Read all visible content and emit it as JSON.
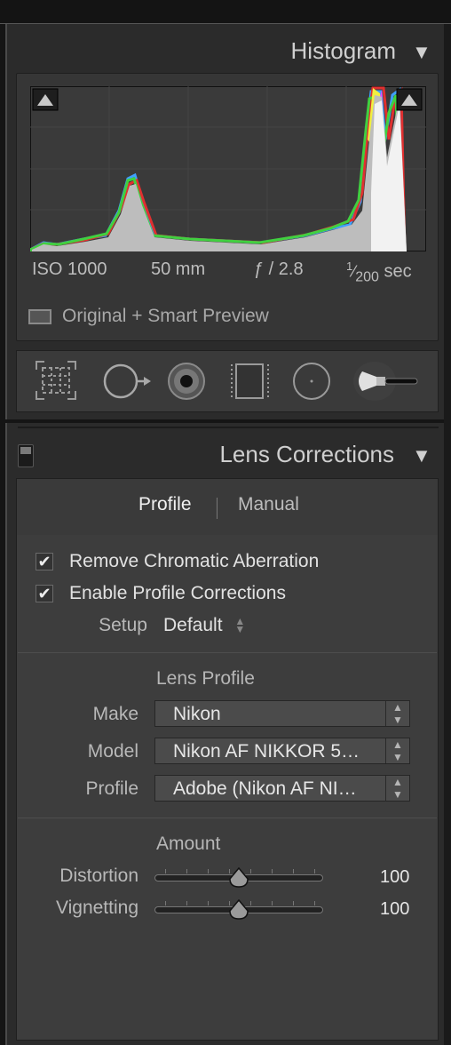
{
  "histogram_panel": {
    "title": "Histogram",
    "collapse_glyph": "▼",
    "metadata": {
      "iso": "ISO 1000",
      "focal_length": "50 mm",
      "aperture": "ƒ / 2.8",
      "shutter_num": "1",
      "shutter_den": "200",
      "shutter_unit": "sec"
    },
    "preview_status": "Original + Smart Preview"
  },
  "tool_strip": {
    "tools": [
      "crop-overlay-icon",
      "spot-removal-icon",
      "red-eye-icon",
      "graduated-filter-icon",
      "radial-filter-icon",
      "adjustment-brush-icon"
    ]
  },
  "lens_corrections": {
    "title": "Lens Corrections",
    "collapse_glyph": "▼",
    "tabs": [
      {
        "label": "Profile",
        "active": true
      },
      {
        "label": "Manual",
        "active": false
      }
    ],
    "remove_ca": {
      "label": "Remove Chromatic Aberration",
      "checked": true
    },
    "enable_profile": {
      "label": "Enable Profile Corrections",
      "checked": true
    },
    "setup": {
      "label": "Setup",
      "value": "Default"
    },
    "lens_profile": {
      "title": "Lens Profile",
      "make": {
        "label": "Make",
        "value": "Nikon"
      },
      "model": {
        "label": "Model",
        "value": "Nikon AF NIKKOR 5…"
      },
      "profile": {
        "label": "Profile",
        "value": "Adobe (Nikon AF NI…"
      }
    },
    "amount": {
      "title": "Amount",
      "distortion": {
        "label": "Distortion",
        "value": "100",
        "fraction": 0.5
      },
      "vignetting": {
        "label": "Vignetting",
        "value": "100",
        "fraction": 0.5
      }
    }
  },
  "colors": {
    "panel_bg": "#3d3d3d",
    "accent_text": "#f0f0f0"
  }
}
